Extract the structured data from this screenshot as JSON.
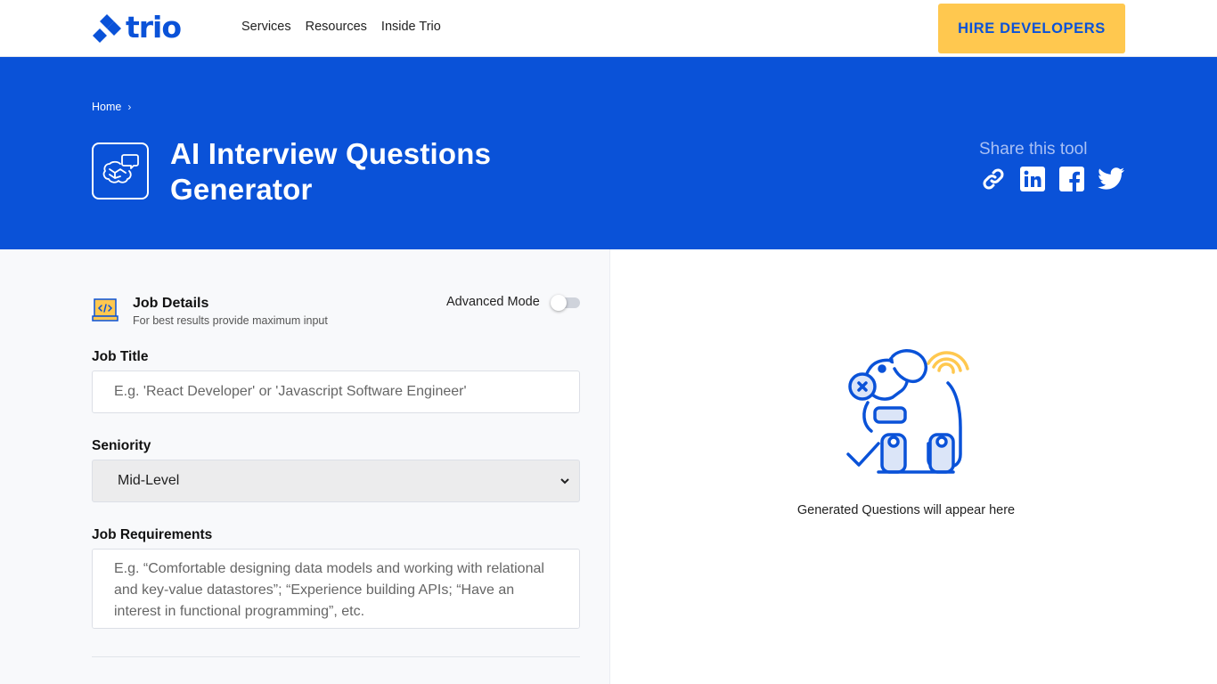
{
  "header": {
    "brand": "trio",
    "nav": [
      "Services",
      "Resources",
      "Inside Trio"
    ],
    "cta": "HIRE DEVELOPERS"
  },
  "hero": {
    "breadcrumb": [
      "Home"
    ],
    "title": "AI Interview Questions Generator",
    "share_label": "Share this tool",
    "share_icons": [
      "link-icon",
      "linkedin-icon",
      "facebook-icon",
      "twitter-icon"
    ]
  },
  "form": {
    "section_title": "Job Details",
    "section_subtitle": "For best results provide maximum input",
    "advanced_mode_label": "Advanced Mode",
    "advanced_mode_on": false,
    "job_title_label": "Job Title",
    "job_title_placeholder": "E.g. 'React Developer' or 'Javascript Software Engineer'",
    "seniority_label": "Seniority",
    "seniority_value": "Mid-Level",
    "requirements_label": "Job Requirements",
    "requirements_placeholder": "E.g. “Comfortable designing data models and working with relational and key-value datastores”; “Experience building APIs; “Have an interest in functional programming”, etc."
  },
  "output": {
    "empty_message": "Generated Questions will appear here"
  },
  "colors": {
    "brand_blue": "#0a52d8",
    "cta_yellow": "#ffc84f",
    "panel_gray": "#f8f9fb"
  }
}
